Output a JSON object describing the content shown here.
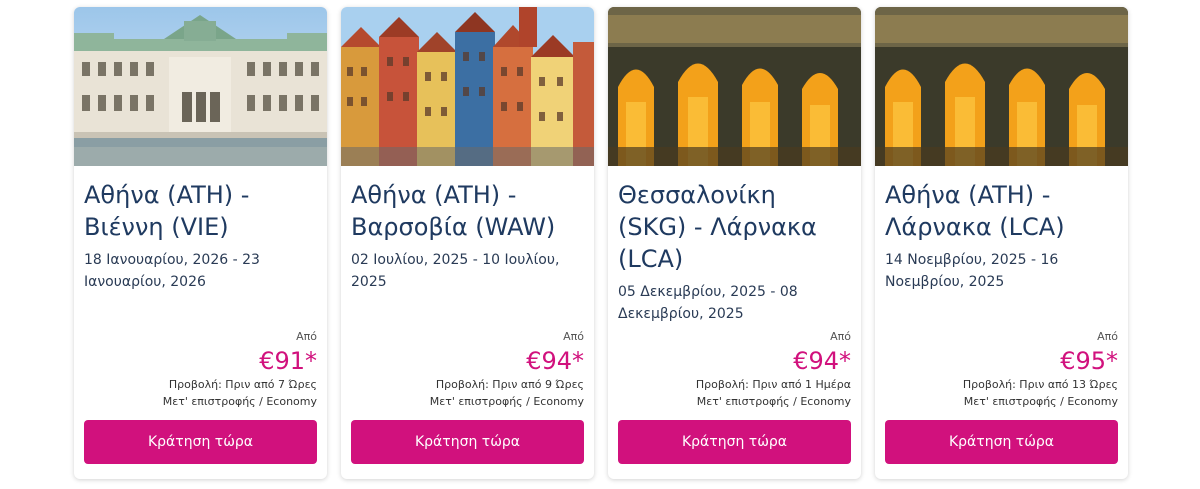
{
  "colors": {
    "accent": "#d1117d",
    "title": "#1f3a60"
  },
  "cards": [
    {
      "route": "Αθήνα (ATH) - Βιέννη (VIE)",
      "dates": "18 Ιανουαρίου, 2026 - 23 Ιανουαρίου, 2026",
      "from_label": "Από",
      "price": "€91*",
      "posted": "Προβολή: Πριν από 7 Ώρες",
      "trip": "Μετ' επιστροφής / Economy",
      "button": "Κράτηση τώρα"
    },
    {
      "route": "Αθήνα (ATH) - Βαρσοβία (WAW)",
      "dates": "02 Ιουλίου, 2025 - 10 Ιουλίου, 2025",
      "from_label": "Από",
      "price": "€94*",
      "posted": "Προβολή: Πριν από 9 Ώρες",
      "trip": "Μετ' επιστροφής / Economy",
      "button": "Κράτηση τώρα"
    },
    {
      "route": "Θεσσαλονίκη (SKG) - Λάρνακα (LCA)",
      "dates": "05 Δεκεμβρίου, 2025 - 08 Δεκεμβρίου, 2025",
      "from_label": "Από",
      "price": "€94*",
      "posted": "Προβολή: Πριν από 1 Ημέρα",
      "trip": "Μετ' επιστροφής / Economy",
      "button": "Κράτηση τώρα"
    },
    {
      "route": "Αθήνα (ATH) - Λάρνακα (LCA)",
      "dates": "14 Νοεμβρίου, 2025 - 16 Νοεμβρίου, 2025",
      "from_label": "Από",
      "price": "€95*",
      "posted": "Προβολή: Πριν από 13 Ώρες",
      "trip": "Μετ' επιστροφής / Economy",
      "button": "Κράτηση τώρα"
    }
  ]
}
